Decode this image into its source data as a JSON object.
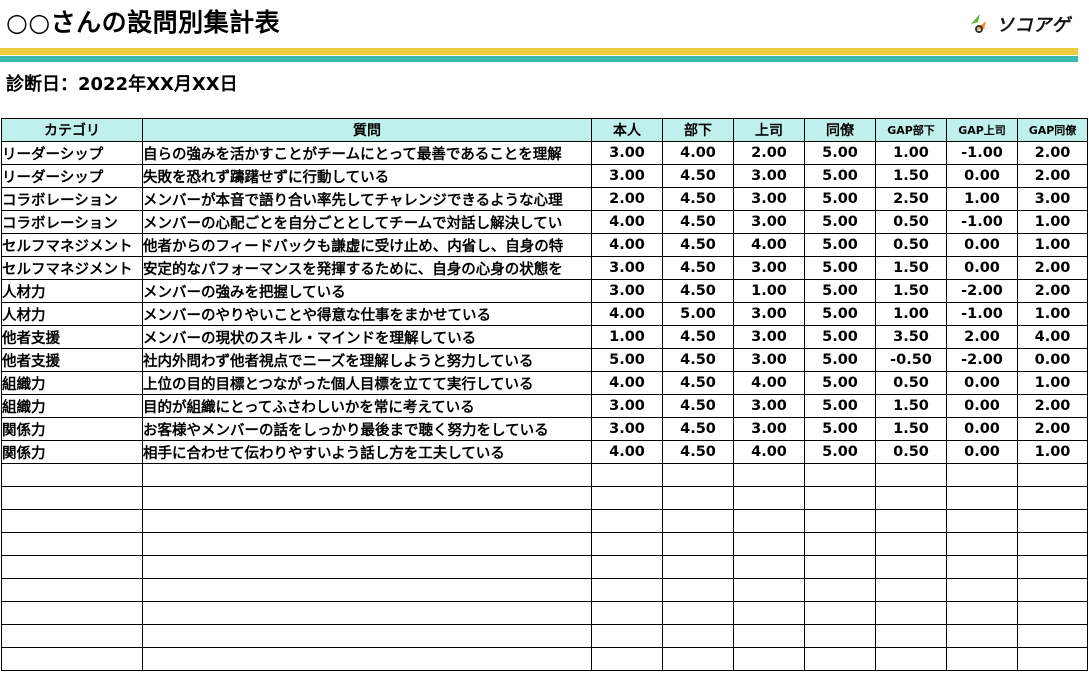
{
  "title": "○○さんの設問別集計表",
  "logo_text": "ソコアゲ",
  "date_line": "診断日：2022年XX月XX日",
  "table": {
    "headers": [
      "カテゴリ",
      "質問",
      "本人",
      "部下",
      "上司",
      "同僚",
      "GAP部下",
      "GAP上司",
      "GAP同僚"
    ],
    "rows": [
      [
        "リーダーシップ",
        "自らの強みを活かすことがチームにとって最善であることを理解",
        "3.00",
        "4.00",
        "2.00",
        "5.00",
        "1.00",
        "-1.00",
        "2.00"
      ],
      [
        "リーダーシップ",
        "失敗を恐れず躊躇せずに行動している",
        "3.00",
        "4.50",
        "3.00",
        "5.00",
        "1.50",
        "0.00",
        "2.00"
      ],
      [
        "コラボレーション",
        "メンバーが本音で語り合い率先してチャレンジできるような心理",
        "2.00",
        "4.50",
        "3.00",
        "5.00",
        "2.50",
        "1.00",
        "3.00"
      ],
      [
        "コラボレーション",
        "メンバーの心配ごとを自分ごととしてチームで対話し解決してい",
        "4.00",
        "4.50",
        "3.00",
        "5.00",
        "0.50",
        "-1.00",
        "1.00"
      ],
      [
        "セルフマネジメント",
        "他者からのフィードバックも謙虚に受け止め、内省し、自身の特",
        "4.00",
        "4.50",
        "4.00",
        "5.00",
        "0.50",
        "0.00",
        "1.00"
      ],
      [
        "セルフマネジメント",
        "安定的なパフォーマンスを発揮するために、自身の心身の状態を",
        "3.00",
        "4.50",
        "3.00",
        "5.00",
        "1.50",
        "0.00",
        "2.00"
      ],
      [
        "人材力",
        "メンバーの強みを把握している",
        "3.00",
        "4.50",
        "1.00",
        "5.00",
        "1.50",
        "-2.00",
        "2.00"
      ],
      [
        "人材力",
        "メンバーのやりやいことや得意な仕事をまかせている",
        "4.00",
        "5.00",
        "3.00",
        "5.00",
        "1.00",
        "-1.00",
        "1.00"
      ],
      [
        "他者支援",
        "メンバーの現状のスキル・マインドを理解している",
        "1.00",
        "4.50",
        "3.00",
        "5.00",
        "3.50",
        "2.00",
        "4.00"
      ],
      [
        "他者支援",
        "社内外問わず他者視点でニーズを理解しようと努力している",
        "5.00",
        "4.50",
        "3.00",
        "5.00",
        "-0.50",
        "-2.00",
        "0.00"
      ],
      [
        "組織力",
        "上位の目的目標とつながった個人目標を立てて実行している",
        "4.00",
        "4.50",
        "4.00",
        "5.00",
        "0.50",
        "0.00",
        "1.00"
      ],
      [
        "組織力",
        "目的が組織にとってふさわしいかを常に考えている",
        "3.00",
        "4.50",
        "3.00",
        "5.00",
        "1.50",
        "0.00",
        "2.00"
      ],
      [
        "関係力",
        "お客様やメンバーの話をしっかり最後まで聴く努力をしている",
        "3.00",
        "4.50",
        "3.00",
        "5.00",
        "1.50",
        "0.00",
        "2.00"
      ],
      [
        "関係力",
        "相手に合わせて伝わりやすいよう話し方を工夫している",
        "4.00",
        "4.50",
        "4.00",
        "5.00",
        "0.50",
        "0.00",
        "1.00"
      ]
    ],
    "empty_rows": 9
  },
  "colors": {
    "header_bg": "#bff0ec",
    "band_yellow": "#f0cd3c",
    "band_teal": "#3cb9ad",
    "logo_green": "#5cb82e",
    "logo_orange": "#f28a1e"
  }
}
